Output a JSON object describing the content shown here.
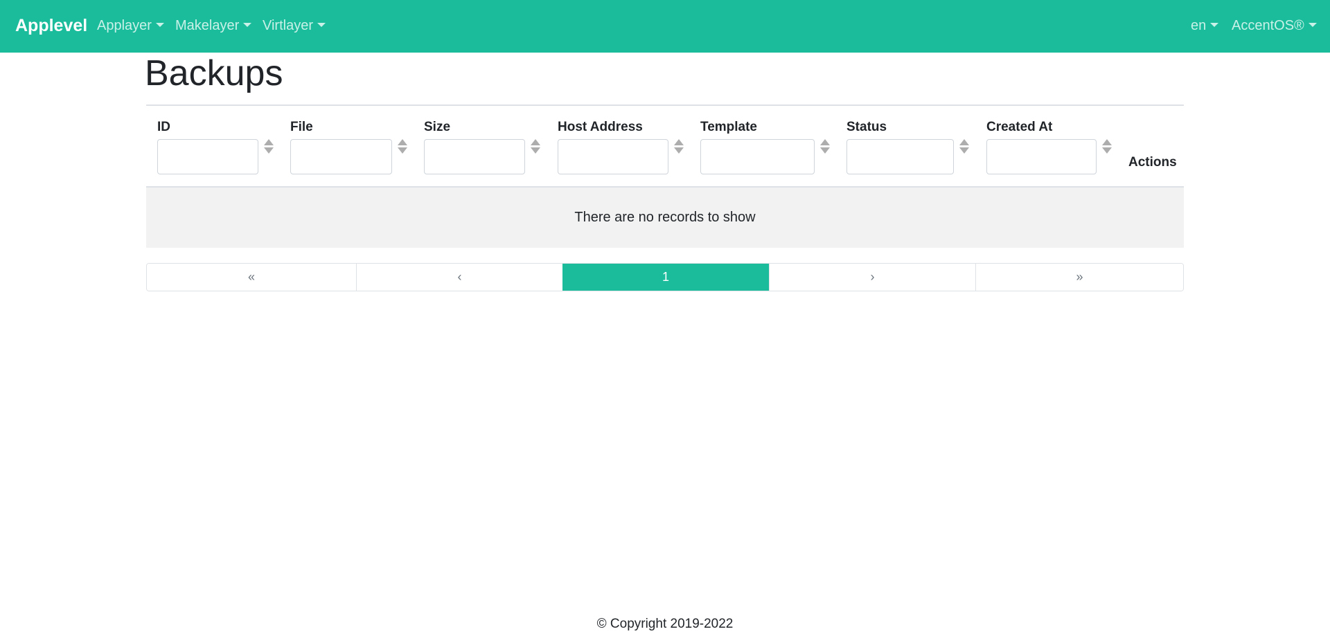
{
  "navbar": {
    "brand": "Applevel",
    "menus": [
      {
        "label": "Applayer"
      },
      {
        "label": "Makelayer"
      },
      {
        "label": "Virtlayer"
      }
    ],
    "language": "en",
    "product": "AccentOS®",
    "color": "#1abc9c"
  },
  "page": {
    "title": "Backups"
  },
  "table": {
    "columns": [
      {
        "label": "ID"
      },
      {
        "label": "File"
      },
      {
        "label": "Size"
      },
      {
        "label": "Host Address"
      },
      {
        "label": "Template"
      },
      {
        "label": "Status"
      },
      {
        "label": "Created At"
      }
    ],
    "actions_label": "Actions",
    "empty_message": "There are no records to show"
  },
  "pagination": {
    "first": "«",
    "prev": "‹",
    "current": "1",
    "next": "›",
    "last": "»"
  },
  "footer": {
    "copyright": "© Copyright 2019-2022"
  }
}
